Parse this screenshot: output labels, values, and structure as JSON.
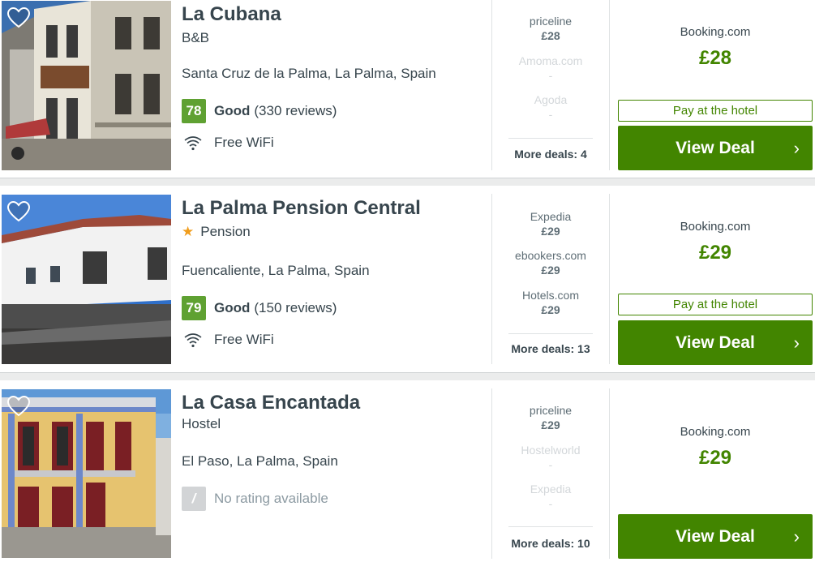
{
  "colors": {
    "accent_green": "#428500",
    "rating_green": "#5fa132",
    "star_orange": "#f09d1c",
    "text_dark": "#37454d"
  },
  "hotels": [
    {
      "name": "La Cubana",
      "type": "B&B",
      "has_star": false,
      "location": "Santa Cruz de la Palma, La Palma, Spain",
      "rating": {
        "score": "78",
        "word": "Good",
        "reviews": "(330 reviews)"
      },
      "amenity": {
        "icon": "wifi-icon",
        "label": "Free WiFi"
      },
      "deals": [
        {
          "provider": "priceline",
          "price": "£28",
          "available": true
        },
        {
          "provider": "Amoma.com",
          "price": "-",
          "available": false
        },
        {
          "provider": "Agoda",
          "price": "-",
          "available": false
        }
      ],
      "more_deals": "More deals: 4",
      "best": {
        "provider": "Booking.com",
        "price": "£28",
        "pay_at_hotel": "Pay at the hotel",
        "cta": "View Deal"
      }
    },
    {
      "name": "La Palma Pension Central",
      "type": "Pension",
      "has_star": true,
      "location": "Fuencaliente, La Palma, Spain",
      "rating": {
        "score": "79",
        "word": "Good",
        "reviews": "(150 reviews)"
      },
      "amenity": {
        "icon": "wifi-icon",
        "label": "Free WiFi"
      },
      "deals": [
        {
          "provider": "Expedia",
          "price": "£29",
          "available": true
        },
        {
          "provider": "ebookers.com",
          "price": "£29",
          "available": true
        },
        {
          "provider": "Hotels.com",
          "price": "£29",
          "available": true
        }
      ],
      "more_deals": "More deals: 13",
      "best": {
        "provider": "Booking.com",
        "price": "£29",
        "pay_at_hotel": "Pay at the hotel",
        "cta": "View Deal"
      }
    },
    {
      "name": "La Casa Encantada",
      "type": "Hostel",
      "has_star": false,
      "location": "El Paso, La Palma, Spain",
      "rating": {
        "score": "/",
        "word": "",
        "reviews": "No rating available"
      },
      "amenity": null,
      "deals": [
        {
          "provider": "priceline",
          "price": "£29",
          "available": true
        },
        {
          "provider": "Hostelworld",
          "price": "-",
          "available": false
        },
        {
          "provider": "Expedia",
          "price": "-",
          "available": false
        }
      ],
      "more_deals": "More deals: 10",
      "best": {
        "provider": "Booking.com",
        "price": "£29",
        "pay_at_hotel": "",
        "cta": "View Deal"
      }
    }
  ]
}
